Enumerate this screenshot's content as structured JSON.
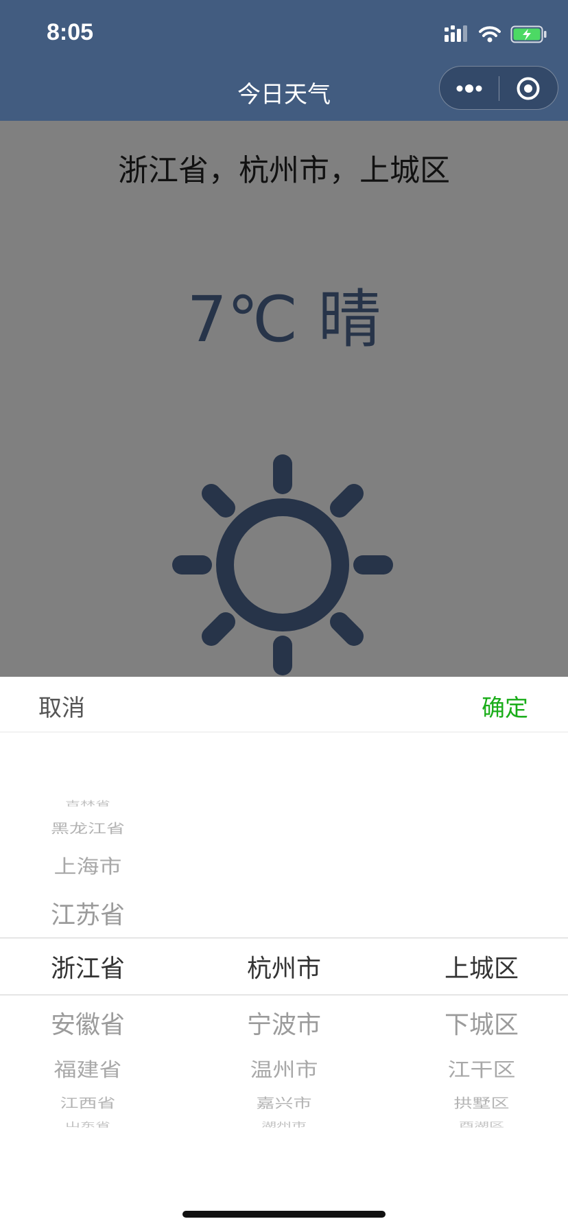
{
  "status": {
    "time": "8:05"
  },
  "nav": {
    "title": "今日天气"
  },
  "colors": {
    "nav": "#425c80",
    "mask": "#808080",
    "accent": "#1aad19",
    "icon": "#273449"
  },
  "weather": {
    "location": "浙江省，杭州市，上城区",
    "temperature": "7℃",
    "condition": "晴",
    "icon": "sun-icon"
  },
  "picker": {
    "cancel_label": "取消",
    "confirm_label": "确定",
    "provinces": {
      "above": [
        "吉林省",
        "黑龙江省",
        "上海市",
        "江苏省"
      ],
      "selected": "浙江省",
      "below": [
        "安徽省",
        "福建省",
        "江西省",
        "山东省"
      ]
    },
    "cities": {
      "selected": "杭州市",
      "below": [
        "宁波市",
        "温州市",
        "嘉兴市",
        "湖州市"
      ]
    },
    "districts": {
      "selected": "上城区",
      "below": [
        "下城区",
        "江干区",
        "拱墅区",
        "西湖区"
      ]
    }
  }
}
